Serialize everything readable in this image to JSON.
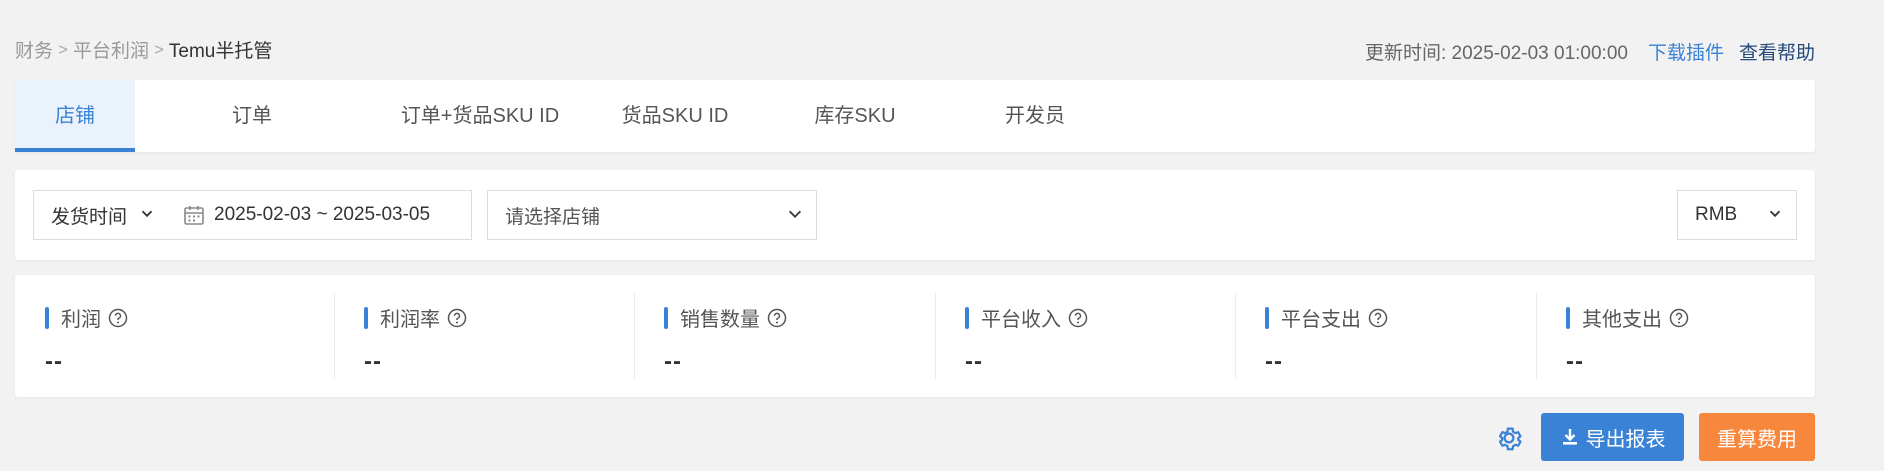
{
  "breadcrumb": {
    "items": [
      "财务",
      "平台利润",
      "Temu半托管"
    ],
    "separator": ">"
  },
  "header": {
    "update_label": "更新时间:",
    "update_time": "2025-02-03 01:00:00",
    "download_plugin": "下载插件",
    "view_help": "查看帮助"
  },
  "tabs": [
    {
      "label": "店铺",
      "active": true
    },
    {
      "label": "订单",
      "active": false
    },
    {
      "label": "订单+货品SKU ID",
      "active": false
    },
    {
      "label": "货品SKU ID",
      "active": false
    },
    {
      "label": "库存SKU",
      "active": false
    },
    {
      "label": "开发员",
      "active": false
    }
  ],
  "filters": {
    "date_type": "发货时间",
    "date_range": "2025-02-03 ~ 2025-03-05",
    "store_placeholder": "请选择店铺",
    "currency": "RMB"
  },
  "stats": [
    {
      "label": "利润",
      "value": "--"
    },
    {
      "label": "利润率",
      "value": "--"
    },
    {
      "label": "销售数量",
      "value": "--"
    },
    {
      "label": "平台收入",
      "value": "--"
    },
    {
      "label": "平台支出",
      "value": "--"
    },
    {
      "label": "其他支出",
      "value": "--"
    }
  ],
  "actions": {
    "export": "导出报表",
    "recalculate": "重算费用"
  },
  "colors": {
    "accent": "#3a82d6",
    "orange": "#f7873d",
    "background": "#f2f2f2"
  }
}
